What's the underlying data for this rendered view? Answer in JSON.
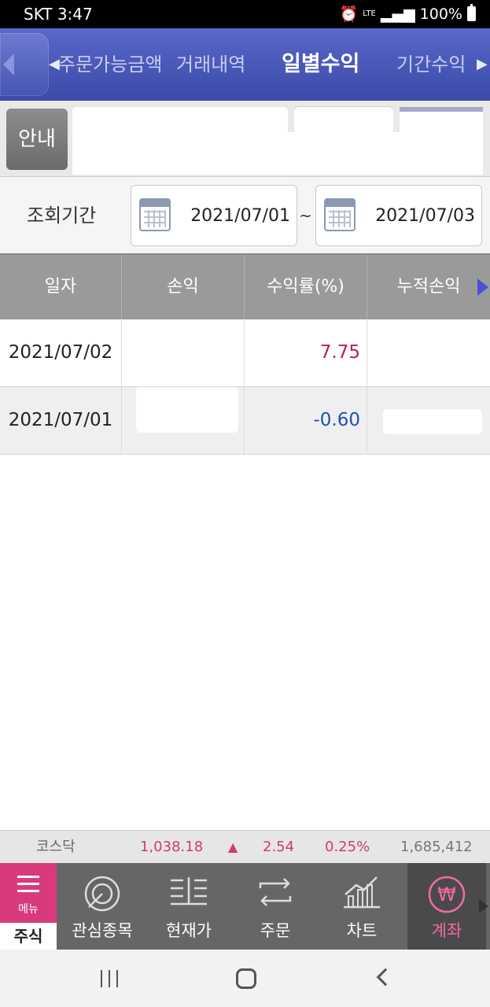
{
  "status_bar": {
    "carrier_time": "SKT 3:47",
    "network": "LTE",
    "battery": "100%"
  },
  "tabs": [
    "주문가능금액",
    "거래내역",
    "일별수익",
    "기간수익"
  ],
  "active_tab": "일별수익",
  "info_button": "안내",
  "period": {
    "label": "조회기간",
    "start": "2021/07/01",
    "separator": "~",
    "end": "2021/07/03"
  },
  "table": {
    "headers": [
      "일자",
      "손익",
      "수익률(%)",
      "누적손익"
    ],
    "rows": [
      {
        "date": "2021/07/02",
        "pnl": "",
        "rate": "7.75",
        "cumulative": ""
      },
      {
        "date": "2021/07/01",
        "pnl": "",
        "rate": "-0.60",
        "cumulative": ""
      }
    ]
  },
  "ticker": {
    "name": "코스닥",
    "price": "1,038.18",
    "arrow": "▲",
    "change": "2.54",
    "percent": "0.25%",
    "volume": "1,685,412"
  },
  "bottom_nav": {
    "menu_label": "메뉴",
    "section_label": "주식",
    "items": [
      "관심종목",
      "현재가",
      "주문",
      "차트",
      "계좌"
    ],
    "active": "계좌"
  },
  "colors": {
    "header": "#4655b2",
    "accent_pink": "#d93a7d",
    "up": "#c2185b",
    "down": "#1e4fb5"
  }
}
